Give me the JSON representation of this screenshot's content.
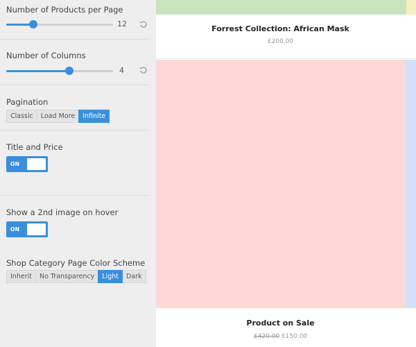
{
  "settings": {
    "products_per_page": {
      "label": "Number of Products per Page",
      "value": "12",
      "fraction": 0.25
    },
    "columns": {
      "label": "Number of Columns",
      "value": "4",
      "fraction": 0.6
    },
    "pagination": {
      "label": "Pagination",
      "options": [
        "Classic",
        "Load More",
        "Infinite"
      ],
      "selected": "Infinite"
    },
    "title_price": {
      "label": "Title and Price",
      "state": "ON"
    },
    "second_image": {
      "label": "Show a 2nd image on hover",
      "state": "ON"
    },
    "color_scheme": {
      "label": "Shop Category Page Color Scheme",
      "options": [
        "Inherit",
        "No Transparency",
        "Light",
        "Dark"
      ],
      "selected": "Light"
    }
  },
  "products": [
    {
      "title": "Forrest Collection: African Mask",
      "price": "£200.00"
    },
    {
      "title": "Product on Sale",
      "old_price": "£420.00",
      "price": "£150.00"
    }
  ],
  "colors": {
    "accent": "#3a8fdc",
    "panel_bg": "#eeeeee",
    "placeholder_green": "#c8e3be",
    "placeholder_yellow": "#f6efc2",
    "placeholder_pink": "#fed7d7",
    "placeholder_blue": "#d3e0f5"
  }
}
